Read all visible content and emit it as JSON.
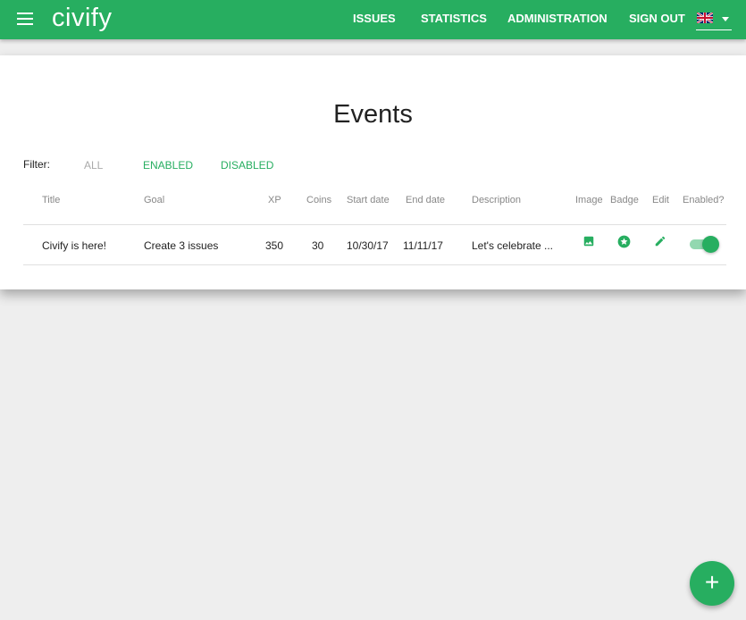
{
  "header": {
    "logo": "civify",
    "nav": [
      "ISSUES",
      "STATISTICS",
      "ADMINISTRATION",
      "SIGN OUT"
    ],
    "language": "English (UK flag)"
  },
  "page": {
    "title": "Events",
    "filter_label": "Filter:",
    "filters": [
      "ALL",
      "ENABLED",
      "DISABLED"
    ]
  },
  "table": {
    "headers": [
      "Title",
      "Goal",
      "XP",
      "Coins",
      "Start date",
      "End date",
      "Description",
      "Image",
      "Badge",
      "Edit",
      "Enabled?"
    ],
    "rows": [
      {
        "title": "Civify is here!",
        "goal": "Create 3 issues",
        "xp": "350",
        "coins": "30",
        "start": "10/30/17",
        "end": "11/11/17",
        "description": "Let's celebrate ...",
        "enabled": true
      }
    ]
  },
  "fab": "+",
  "colors": {
    "primary": "#27ae60",
    "toggle_track": "#93d8b0"
  }
}
